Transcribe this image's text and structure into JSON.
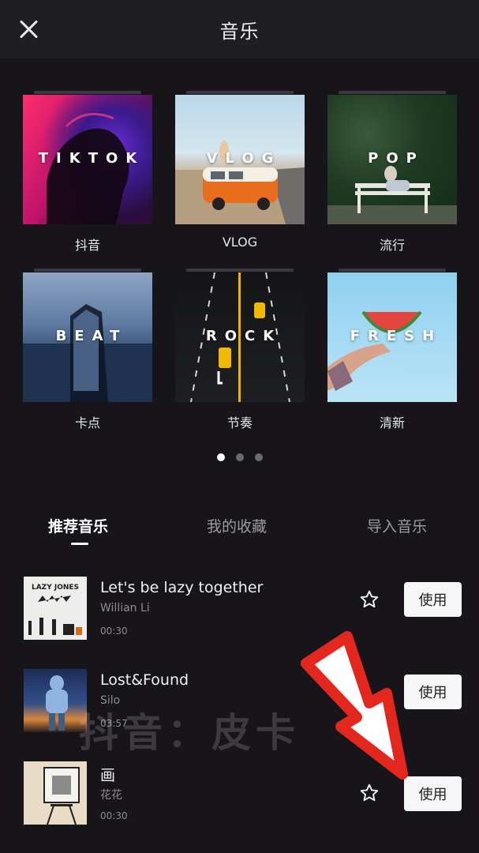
{
  "header": {
    "title": "音乐"
  },
  "categories": [
    {
      "cover_text": "TIKTOK",
      "label": "抖音"
    },
    {
      "cover_text": "VLOG",
      "label": "VLOG"
    },
    {
      "cover_text": "POP",
      "label": "流行"
    },
    {
      "cover_text": "BEAT",
      "label": "卡点"
    },
    {
      "cover_text": "ROCK",
      "label": "节奏"
    },
    {
      "cover_text": "FRESH",
      "label": "清新"
    }
  ],
  "pager": {
    "pages": 3,
    "active": 1
  },
  "tabs": [
    {
      "label": "推荐音乐",
      "active": true
    },
    {
      "label": "我的收藏",
      "active": false
    },
    {
      "label": "导入音乐",
      "active": false
    }
  ],
  "songs": [
    {
      "title": "Let's be lazy together",
      "artist": "Willian Li",
      "duration": "00:30",
      "cover_text": "LAZY JONES",
      "use_label": "使用"
    },
    {
      "title": "Lost&Found",
      "artist": "Silo",
      "duration": "03:57",
      "use_label": "使用"
    },
    {
      "title": "画",
      "artist": "花花",
      "duration": "00:30",
      "use_label": "使用"
    }
  ],
  "watermark": "抖音：皮卡",
  "colors": {
    "background": "#17151a",
    "topbar": "#1f1e22",
    "button_bg": "#f6f6f7",
    "arrow_red": "#e3261e"
  }
}
